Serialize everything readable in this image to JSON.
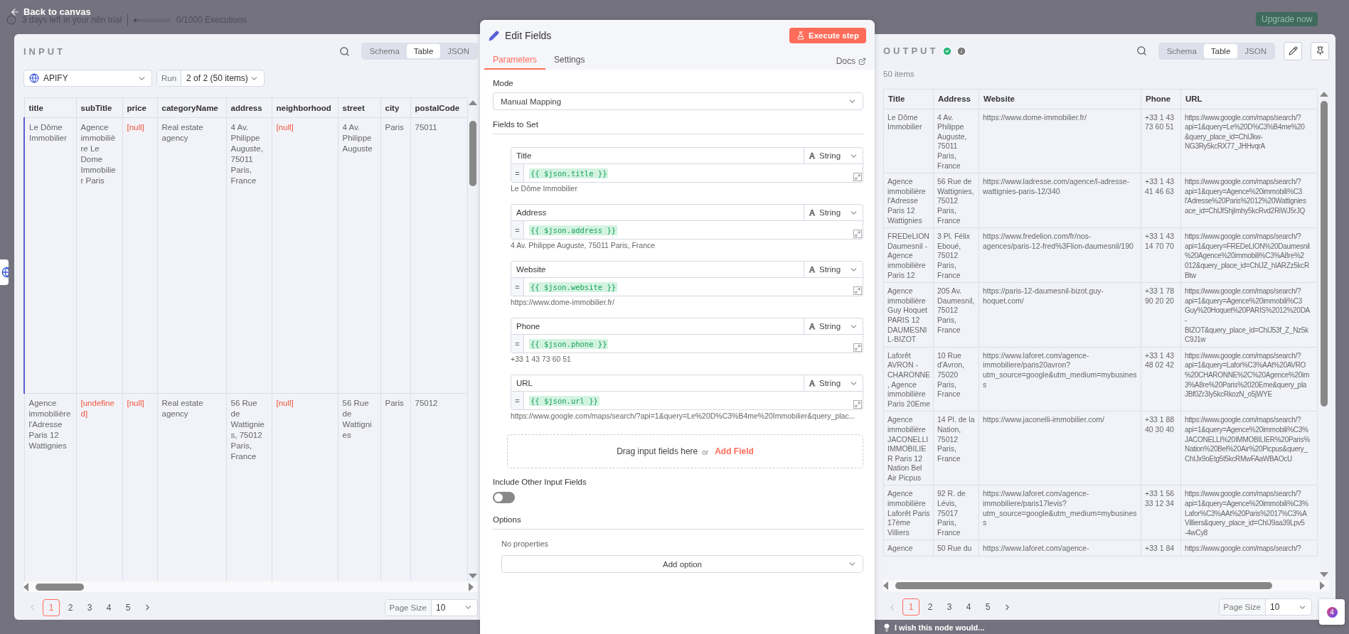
{
  "top_bar": {
    "back_label": "Back to canvas",
    "trial_text": "3 days left in your n8n trial",
    "executions": {
      "label": "0/1000 Executions",
      "level": 0
    },
    "upgrade_label": "Upgrade now"
  },
  "input": {
    "title": "INPUT",
    "views": [
      {
        "label": "Schema",
        "selected": false
      },
      {
        "label": "Table",
        "selected": true
      },
      {
        "label": "JSON",
        "selected": false
      }
    ],
    "node_select": "APIFY",
    "run_label": "Run",
    "run_select": "2 of 2 (50 items)",
    "table": {
      "columns": [
        "title",
        "subTitle",
        "price",
        "categoryName",
        "address",
        "neighborhood",
        "street",
        "city",
        "postalCode"
      ],
      "rows": [
        {
          "selected": true,
          "cells": [
            {
              "text": "Le Dôme Immobilier",
              "kind": "text"
            },
            {
              "text": "Agence immobilière Le Dome Immobilier Paris",
              "kind": "text"
            },
            {
              "text": "[null]",
              "kind": "null"
            },
            {
              "text": "Real estate agency",
              "kind": "text"
            },
            {
              "text": "4 Av. Philippe Auguste, 75011 Paris, France",
              "kind": "text"
            },
            {
              "text": "[null]",
              "kind": "null"
            },
            {
              "text": "4 Av. Philippe Auguste",
              "kind": "text"
            },
            {
              "text": "Paris",
              "kind": "text"
            },
            {
              "text": "75011",
              "kind": "text"
            }
          ]
        },
        {
          "selected": false,
          "cells": [
            {
              "text": "Agence immobilière l'Adresse Paris 12 Wattignies",
              "kind": "text"
            },
            {
              "text": "[undefined]",
              "kind": "null"
            },
            {
              "text": "[null]",
              "kind": "null"
            },
            {
              "text": "Real estate agency",
              "kind": "text"
            },
            {
              "text": "56 Rue de Wattignies, 75012 Paris, France",
              "kind": "text"
            },
            {
              "text": "[null]",
              "kind": "null"
            },
            {
              "text": "56 Rue de Wattignies",
              "kind": "text"
            },
            {
              "text": "Paris",
              "kind": "text"
            },
            {
              "text": "75012",
              "kind": "text"
            }
          ]
        }
      ]
    },
    "pagination": {
      "pages": [
        {
          "label": "1",
          "selected": true
        },
        {
          "label": "2",
          "selected": false
        },
        {
          "label": "3",
          "selected": false
        },
        {
          "label": "4",
          "selected": false
        },
        {
          "label": "5",
          "selected": false
        }
      ],
      "page_size_label": "Page Size",
      "page_size": "10"
    }
  },
  "editor": {
    "title": "Edit Fields",
    "execute_label": "Execute step",
    "tabs": [
      {
        "label": "Parameters",
        "selected": true
      },
      {
        "label": "Settings",
        "selected": false
      }
    ],
    "docs_label": "Docs",
    "mode_label": "Mode",
    "mode_value": "Manual Mapping",
    "fields_label": "Fields to Set",
    "fields": [
      {
        "name": "Title",
        "type": "String",
        "prefix": "=",
        "expression": "{{ $json.title }}",
        "preview": "Le Dôme Immobilier"
      },
      {
        "name": "Address",
        "type": "String",
        "prefix": "=",
        "expression": "{{ $json.address }}",
        "preview": "4 Av. Philippe Auguste, 75011 Paris, France"
      },
      {
        "name": "Website",
        "type": "String",
        "prefix": "=",
        "expression": "{{ $json.website }}",
        "preview": "https://www.dome-immobilier.fr/"
      },
      {
        "name": "Phone",
        "type": "String",
        "prefix": "=",
        "expression": "{{ $json.phone }}",
        "preview": "+33 1 43 73 60 51"
      },
      {
        "name": "URL",
        "type": "String",
        "prefix": "=",
        "expression": "{{ $json.url }}",
        "preview": "https://www.google.com/maps/search/?api=1&query=Le%20D%C3%B4me%20Immobilier&query_plac..."
      }
    ],
    "drop_text": "Drag input fields here",
    "drop_or": "or",
    "add_field": "Add Field",
    "include_label": "Include Other Input Fields",
    "include_on": false,
    "options_label": "Options",
    "no_properties": "No properties",
    "add_option": "Add option"
  },
  "output": {
    "title": "OUTPUT",
    "items_count": "50 items",
    "views": [
      {
        "label": "Schema",
        "selected": false
      },
      {
        "label": "Table",
        "selected": true
      },
      {
        "label": "JSON",
        "selected": false
      }
    ],
    "table": {
      "columns": [
        "Title",
        "Address",
        "Website",
        "Phone",
        "URL"
      ],
      "rows": [
        {
          "cells": [
            "Le Dôme Immobilier",
            "4 Av. Philippe Auguste, 75011 Paris, France",
            "https://www.dome-immobilier.fr/",
            "+33 1 43 73 60 51",
            "https://www.google.com/maps/search/?\napi=1&query=Le%20D%C3%B4me%20\n&query_place_id=ChIJkw-\nNG3Ry5kcRX77_JHHvqrA"
          ]
        },
        {
          "cells": [
            "Agence immobilière l'Adresse Paris 12 Wattignies",
            "56 Rue de Wattignies, 75012 Paris, France",
            "https://www.ladresse.com/agence/l-adresse-wattignies-paris-12/340",
            "+33 1 43 41 46 63",
            "https://www.google.com/maps/search/?\napi=1&query=Agence%20immobili%C3\nl'Adresse%20Paris%2012%20Wattignies\nace_id=ChIJfShjImhy5kcRvd2RiWJ5rJQ"
          ]
        },
        {
          "cells": [
            "FREDeLION Daumesnil - Agence immobilière Paris 12",
            "3 Pl. Félix Eboué, 75012 Paris, France",
            "https://www.fredelion.com/fr/nos-agences/paris-12-fred%3Flion-daumesnil/190",
            "+33 1 43 14 70 70",
            "https://www.google.com/maps/search/?\napi=1&query=FREDeLION%20Daumesnil\n%20Agence%20immobili%C3%A8re%2\n012&query_place_id=ChIJZ_hIARZz5kcR\nBtw"
          ]
        },
        {
          "cells": [
            "Agence immobilière Guy Hoquet PARIS 12 DAUMESNIL-BIZOT",
            "205 Av. Daumesnil, 75012 Paris, France",
            "https://paris-12-daumesnil-bizot.guy-hoquet.com/",
            "+33 1 78 90 20 20",
            "https://www.google.com/maps/search/?\napi=1&query=Agence%20immobili%C3\nGuy%20Hoquet%20PARIS%2012%20DA\n-\nBIZOT&query_place_id=ChIJ53f_Z_Nz5k\nC9J1w"
          ]
        },
        {
          "cells": [
            "Laforêt AVRON - CHARONNE, Agence immobilière Paris 20Eme",
            "10 Rue d'Avron, 75020 Paris, France",
            "https://www.laforet.com/agence-immobiliere/paris20avron?utm_source=google&utm_medium=mybusiness",
            "+33 1 43 48 02 42",
            "https://www.google.com/maps/search/?\napi=1&query=Lafor%C3%AAt%20AVRO\n%20CHARONNE%2C%20Agence%20im\n3%A8re%20Paris%2020Eme&query_pla\nJBf0Zr3Iy5kcRkozN_o5jWYE"
          ]
        },
        {
          "cells": [
            "Agence immobilière JACONELLI IMMOBILIER Paris 12 Nation Bel Air Picpus",
            "14 Pl. de la Nation, 75012 Paris, France",
            "https://www.jaconelli-immobilier.com/",
            "+33 1 88 40 30 40",
            "https://www.google.com/maps/search/?\napi=1&query=Agence%20immobili%C3%\nJACONELLI%20IMMOBILIER%20Paris%\nNation%20Bel%20Air%20Picpus&query_\nChIJx9oEtg5t5kcRMwFAaWBAOcU"
          ]
        },
        {
          "cells": [
            "Agence immobilière Laforêt Paris 17ème Villiers",
            "92 R. de Lévis, 75017 Paris, France",
            "https://www.laforet.com/agence-immobiliere/paris17levis?utm_source=google&utm_medium=mybusiness",
            "+33 1 56 33 12 34",
            "https://www.google.com/maps/search/?\napi=1&query=Agence%20immobili%C3%\nLafor%C3%AAt%20Paris%2017%C3%A\nVilliers&query_place_id=ChIJ9aa39Lpv5\n-4wCy8"
          ]
        },
        {
          "cells": [
            "Agence",
            "50 Rue du",
            "https://www.laforet.com/agence-",
            "+33 1 84",
            "https://www.google.com/maps/search/?"
          ]
        }
      ]
    },
    "pagination": {
      "pages": [
        {
          "label": "1",
          "selected": true
        },
        {
          "label": "2",
          "selected": false
        },
        {
          "label": "3",
          "selected": false
        },
        {
          "label": "4",
          "selected": false
        },
        {
          "label": "5",
          "selected": false
        }
      ],
      "page_size_label": "Page Size",
      "page_size": "10"
    }
  },
  "help_badge": "4",
  "feedback": "I wish this node would..."
}
